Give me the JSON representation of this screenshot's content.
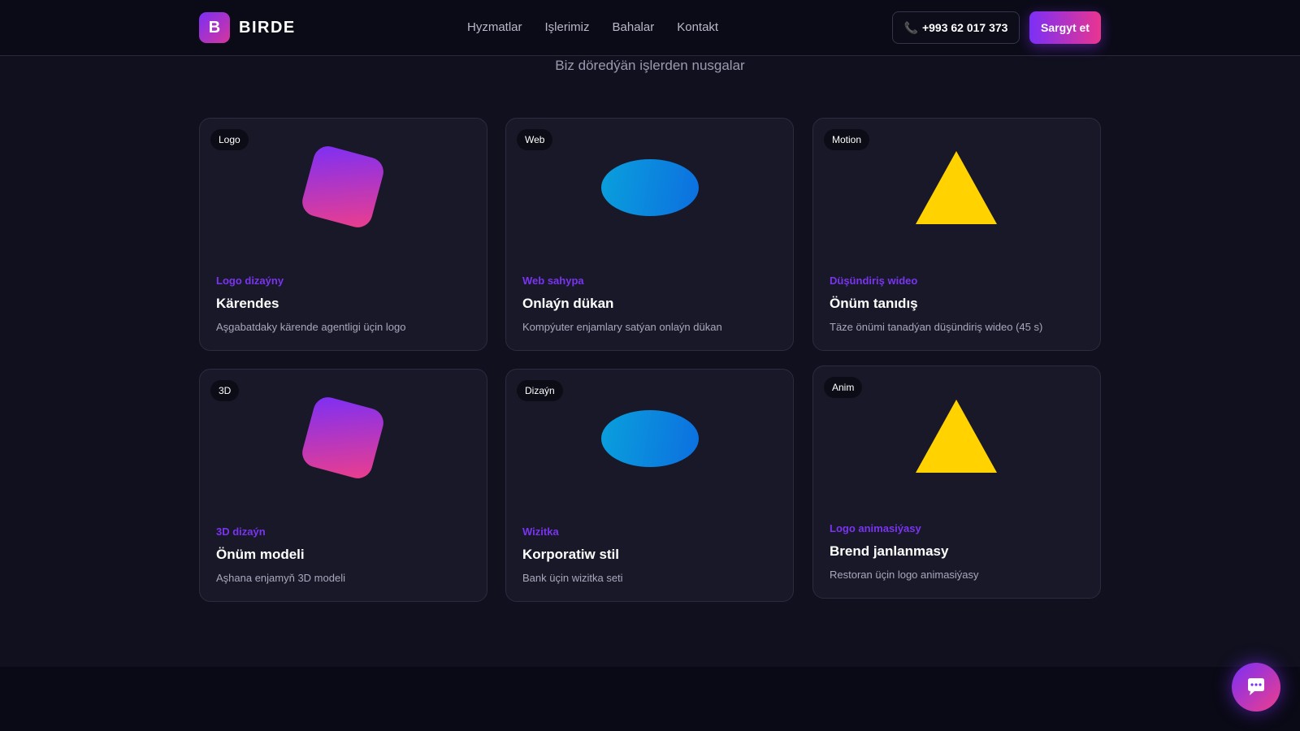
{
  "brand": {
    "logo_letter": "B",
    "name": "BIRDE"
  },
  "nav": [
    "Hyzmatlar",
    "Işlerimiz",
    "Bahalar",
    "Kontakt"
  ],
  "header": {
    "phone": "+993 62 017 373",
    "order_label": "Sargyt et"
  },
  "section": {
    "subtitle": "Biz döredýän işlerden nusgalar"
  },
  "cards": [
    {
      "badge": "Logo",
      "shape": "rounded-square",
      "category": "Logo dizaýny",
      "title": "Kärendes",
      "description": "Aşgabatdaky kärende agentligi üçin logo"
    },
    {
      "badge": "Web",
      "shape": "oval",
      "category": "Web sahypa",
      "title": "Onlaýn dükan",
      "description": "Kompýuter enjamlary satýan onlaýn dükan"
    },
    {
      "badge": "Motion",
      "shape": "triangle",
      "category": "Düşündiriş wideo",
      "title": "Önüm tanıdış",
      "description": "Täze önümi tanadýan düşündiriş wideo (45 s)"
    },
    {
      "badge": "3D",
      "shape": "rounded-square",
      "category": "3D dizaýn",
      "title": "Önüm modeli",
      "description": "Aşhana enjamyň 3D modeli"
    },
    {
      "badge": "Dizaýn",
      "shape": "oval",
      "category": "Wizitka",
      "title": "Korporatiw stil",
      "description": "Bank üçin wizitka seti"
    },
    {
      "badge": "Anim",
      "shape": "triangle",
      "category": "Logo animasiýasy",
      "title": "Brend janlanmasy",
      "description": "Restoran üçin logo animasiýasy"
    }
  ],
  "colors": {
    "accent_purple": "#7b2ff7",
    "accent_pink": "#ee3e8a",
    "oval_blue": "#0c6fe0",
    "triangle_yellow": "#ffd200"
  },
  "icons": {
    "phone": "phone-icon",
    "chat": "chat-bubble-icon"
  }
}
